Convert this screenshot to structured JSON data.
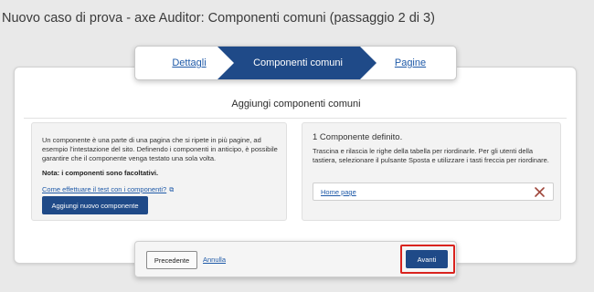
{
  "window": {
    "title": "Nuovo caso di prova - axe Auditor: Componenti comuni (passaggio 2 di 3)"
  },
  "stepper": {
    "steps": [
      {
        "label": "Dettagli",
        "state": "link"
      },
      {
        "label": "Componenti comuni",
        "state": "active"
      },
      {
        "label": "Pagine",
        "state": "link"
      }
    ],
    "active_color": "#1f4a88"
  },
  "main": {
    "heading": "Aggiungi componenti comuni",
    "left_panel": {
      "description": "Un componente è una parte di una pagina che si ripete in più pagine, ad esempio l'intestazione del sito. Definendo i componenti in anticipo, è possibile garantire che il componente venga testato una sola volta.",
      "note": "Nota: i componenti sono facoltativi.",
      "help_link": "Come effettuare il test con i componenti?",
      "help_link_icon": "external-link-icon",
      "add_button": "Aggiungi nuovo componente"
    },
    "right_panel": {
      "count_text": "1 Componente definito.",
      "instructions": "Trascina e rilascia le righe della tabella per riordinarle. Per gli utenti della tastiera, selezionare il pulsante Sposta e utilizzare i tasti freccia per riordinare.",
      "components": [
        {
          "name": "Home page",
          "remove_icon": "close-icon"
        }
      ]
    }
  },
  "footer": {
    "prev_button": "Precedente",
    "cancel_link": "Annulla",
    "next_button": "Avanti",
    "highlight_color": "#d9231e"
  }
}
